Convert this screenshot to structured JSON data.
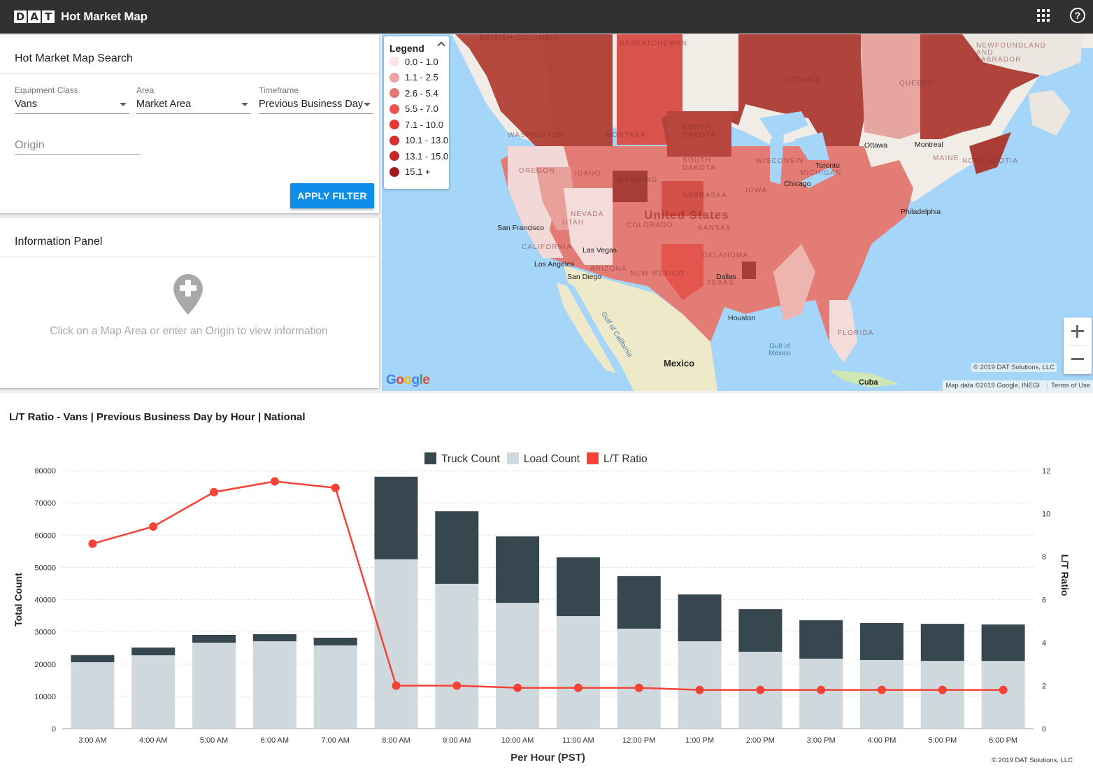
{
  "header": {
    "logo_letters": [
      "D",
      "A",
      "T"
    ],
    "title": "Hot Market Map",
    "apps_icon": "grid-icon",
    "help_icon": "help-circle-icon",
    "help_glyph": "?"
  },
  "search": {
    "title": "Hot Market Map Search",
    "equipment_class": {
      "label": "Equipment Class",
      "value": "Vans"
    },
    "area": {
      "label": "Area",
      "value": "Market Area"
    },
    "timeframe": {
      "label": "Timeframe",
      "value": "Previous Business Day"
    },
    "origin": {
      "placeholder": "Origin",
      "value": ""
    },
    "apply_label": "APPLY FILTER"
  },
  "info_panel": {
    "title": "Information Panel",
    "icon": "add-location-pin-icon",
    "message": "Click on a Map Area or enter an Origin to view information"
  },
  "map": {
    "legend": {
      "title": "Legend",
      "items": [
        {
          "label": "0.0 - 1.0",
          "color": "#fde4e4"
        },
        {
          "label": "1.1 - 2.5",
          "color": "#f0a1a1"
        },
        {
          "label": "2.6 - 5.4",
          "color": "#e57373"
        },
        {
          "label": "5.5 - 7.0",
          "color": "#ef5350"
        },
        {
          "label": "7.1 - 10.0",
          "color": "#e53935"
        },
        {
          "label": "10.1 - 13.0",
          "color": "#d32f2f"
        },
        {
          "label": "13.1 - 15.0",
          "color": "#c62828"
        },
        {
          "label": "15.1 +",
          "color": "#9e1a1a"
        }
      ]
    },
    "region_labels": [
      "BRITISH COLUMBIA",
      "SASKATCHEWAN",
      "ONTARIO",
      "QUEBEC",
      "NEWFOUNDLAND AND LABRADOR",
      "WASHINGTON",
      "MONTANA",
      "NORTH DAKOTA",
      "OREGON",
      "IDAHO",
      "WYOMING",
      "SOUTH DAKOTA",
      "NEBRASKA",
      "NEVADA",
      "UTAH",
      "COLORADO",
      "KANSAS",
      "CALIFORNIA",
      "ARIZONA",
      "NEW MEXICO",
      "OKLAHOMA",
      "TEXAS",
      "MAINE",
      "NOVA SCOTIA",
      "FLORIDA",
      "WISCONSIN",
      "MICHIGAN",
      "IOWA"
    ],
    "country_labels": [
      "United States",
      "Mexico",
      "Cuba"
    ],
    "city_labels": [
      "San Francisco",
      "Los Angeles",
      "San Diego",
      "Las Vegas",
      "Dallas",
      "Houston",
      "Chicago",
      "Toronto",
      "Ottawa",
      "Montreal",
      "Philadelphia"
    ],
    "water_labels": [
      "Gulf of California",
      "Gulf of Mexico"
    ],
    "zoom_in": "+",
    "zoom_out": "−",
    "copyright": "© 2019 DAT Solutions, LLC",
    "map_data": "Map data ©2019 Google, INEGI",
    "terms": "Terms of Use",
    "provider_logo": [
      "G",
      "o",
      "o",
      "g",
      "l",
      "e"
    ]
  },
  "chart": {
    "copyright": "© 2019 DAT Solutions, LLC"
  },
  "chart_data": {
    "type": "bar",
    "title": "L/T Ratio - Vans | Previous Business Day by Hour | National",
    "xlabel": "Per Hour (PST)",
    "ylabel": "Total Count",
    "y2label": "L/T Ratio",
    "ylim": [
      0,
      80000
    ],
    "y2lim": [
      0,
      12
    ],
    "yticks": [
      0,
      10000,
      20000,
      30000,
      40000,
      50000,
      60000,
      70000,
      80000
    ],
    "y2ticks": [
      0,
      2,
      4,
      6,
      8,
      10,
      12
    ],
    "grid": true,
    "stacked": true,
    "legend_position": "top",
    "categories": [
      "3:00 AM",
      "4:00 AM",
      "5:00 AM",
      "6:00 AM",
      "7:00 AM",
      "8:00 AM",
      "9:00 AM",
      "10:00 AM",
      "11:00 AM",
      "12:00 PM",
      "1:00 PM",
      "2:00 PM",
      "3:00 PM",
      "4:00 PM",
      "5:00 PM",
      "6:00 PM"
    ],
    "series": [
      {
        "name": "Truck Count",
        "type": "bar",
        "color": "#37474f",
        "values": [
          2200,
          2400,
          2400,
          2200,
          2400,
          25600,
          22500,
          20600,
          18200,
          16300,
          14500,
          13200,
          11900,
          11500,
          11500,
          11300
        ]
      },
      {
        "name": "Load Count",
        "type": "bar",
        "color": "#cfd8dc",
        "values": [
          20600,
          22750,
          26650,
          27100,
          25800,
          52500,
          44900,
          39000,
          34900,
          31000,
          27100,
          23850,
          21700,
          21250,
          21000,
          21000
        ]
      },
      {
        "name": "L/T Ratio",
        "type": "line",
        "axis": "right",
        "color": "#f44336",
        "values": [
          8.6,
          9.4,
          11.0,
          11.5,
          11.2,
          2.0,
          2.0,
          1.9,
          1.9,
          1.9,
          1.8,
          1.8,
          1.8,
          1.8,
          1.8,
          1.8
        ]
      }
    ]
  }
}
